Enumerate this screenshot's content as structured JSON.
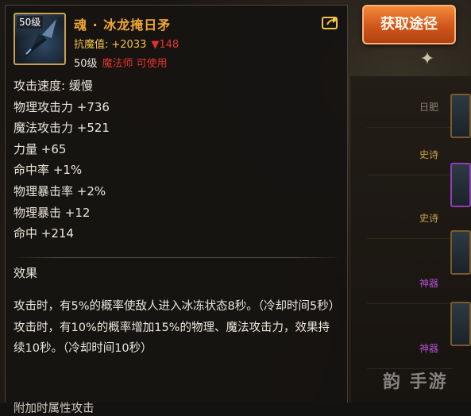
{
  "action_button": {
    "label": "获取途径"
  },
  "item": {
    "level_badge": "50级",
    "name": "魂 · 冰龙掩日矛",
    "resist_label": "抗魔值:",
    "resist_value": "+2033",
    "resist_delta": "▼148",
    "required_level": "50级",
    "usable_by": "魔法师 可使用"
  },
  "stats": [
    "攻击速度: 缓慢",
    "物理攻击力 +736",
    "魔法攻击力 +521",
    "力量 +65",
    "命中率 +1%",
    "物理暴击率 +2%",
    "物理暴击 +12",
    "命中 +214"
  ],
  "effect": {
    "title": "效果",
    "lines": [
      "攻击时，有5%的概率使敌人进入冰冻状态8秒。（冷却时间5秒）",
      "攻击时，有10%的概率增加15%的物理、魔法攻击力，效果持续10秒。（冷却时间10秒）"
    ],
    "cut_line": "附加时属性攻击"
  },
  "background_list": [
    {
      "tag": "日肥",
      "tag_color": "gray"
    },
    {
      "tag": "史诗",
      "tag_color": "gold"
    },
    {
      "tag": "史诗",
      "tag_color": "gold"
    },
    {
      "tag": "神器",
      "tag_color": "purple"
    },
    {
      "tag": "神器",
      "tag_color": "purple"
    }
  ],
  "watermark": "韵 手游",
  "colors": {
    "accent_orange": "#d0561c",
    "item_name": "#f2a733",
    "resist": "#f2c54a",
    "warning_red": "#e0342b",
    "epic_gold": "#c9a24a",
    "artifact_purple": "#b24fd6"
  },
  "icons": [
    "share-icon",
    "sparkle-icon",
    "spear-item-icon"
  ]
}
